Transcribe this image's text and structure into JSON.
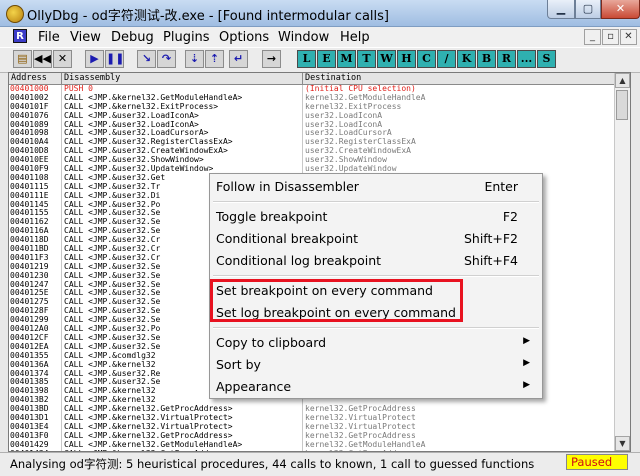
{
  "window": {
    "title": "OllyDbg - od字符测试-改.exe - [Found intermodular calls]"
  },
  "menubar": {
    "items": [
      "File",
      "View",
      "Debug",
      "Plugins",
      "Options",
      "Window",
      "Help"
    ],
    "mdi_icon": "R"
  },
  "toolbar": {
    "letters": [
      "L",
      "E",
      "M",
      "T",
      "W",
      "H",
      "C",
      "/",
      "K",
      "B",
      "R",
      "...",
      "S"
    ]
  },
  "columns": {
    "address": "Address",
    "disassembly": "Disassembly",
    "destination": "Destination"
  },
  "rows": [
    {
      "addr": "00401000",
      "dis": "PUSH 0",
      "dst": "(Initial CPU selection)",
      "selected": true
    },
    {
      "addr": "00401002",
      "dis": "CALL <JMP.&kernel32.GetModuleHandleA>",
      "dst": "kernel32.GetModuleHandleA"
    },
    {
      "addr": "0040101F",
      "dis": "CALL <JMP.&kernel32.ExitProcess>",
      "dst": "kernel32.ExitProcess"
    },
    {
      "addr": "00401076",
      "dis": "CALL <JMP.&user32.LoadIconA>",
      "dst": "user32.LoadIconA"
    },
    {
      "addr": "00401089",
      "dis": "CALL <JMP.&user32.LoadIconA>",
      "dst": "user32.LoadIconA"
    },
    {
      "addr": "00401098",
      "dis": "CALL <JMP.&user32.LoadCursorA>",
      "dst": "user32.LoadCursorA"
    },
    {
      "addr": "004010A4",
      "dis": "CALL <JMP.&user32.RegisterClassExA>",
      "dst": "user32.RegisterClassExA"
    },
    {
      "addr": "004010D8",
      "dis": "CALL <JMP.&user32.CreateWindowExA>",
      "dst": "user32.CreateWindowExA"
    },
    {
      "addr": "004010EE",
      "dis": "CALL <JMP.&user32.ShowWindow>",
      "dst": "user32.ShowWindow"
    },
    {
      "addr": "004010F9",
      "dis": "CALL <JMP.&user32.UpdateWindow>",
      "dst": "user32.UpdateWindow"
    },
    {
      "addr": "00401108",
      "dis": "CALL <JMP.&user32.Get",
      "dst": ""
    },
    {
      "addr": "00401115",
      "dis": "CALL <JMP.&user32.Tr",
      "dst": ""
    },
    {
      "addr": "0040111E",
      "dis": "CALL <JMP.&user32.Di",
      "dst": ""
    },
    {
      "addr": "00401145",
      "dis": "CALL <JMP.&user32.Po",
      "dst": ""
    },
    {
      "addr": "00401155",
      "dis": "CALL <JMP.&user32.Se",
      "dst": ""
    },
    {
      "addr": "00401162",
      "dis": "CALL <JMP.&user32.Se",
      "dst": ""
    },
    {
      "addr": "0040116A",
      "dis": "CALL <JMP.&user32.Se",
      "dst": ""
    },
    {
      "addr": "0040118D",
      "dis": "CALL <JMP.&user32.Cr",
      "dst": ""
    },
    {
      "addr": "004011BD",
      "dis": "CALL <JMP.&user32.Cr",
      "dst": ""
    },
    {
      "addr": "004011F3",
      "dis": "CALL <JMP.&user32.Cr",
      "dst": ""
    },
    {
      "addr": "00401219",
      "dis": "CALL <JMP.&user32.Se",
      "dst": ""
    },
    {
      "addr": "00401230",
      "dis": "CALL <JMP.&user32.Se",
      "dst": ""
    },
    {
      "addr": "00401247",
      "dis": "CALL <JMP.&user32.Se",
      "dst": ""
    },
    {
      "addr": "0040125E",
      "dis": "CALL <JMP.&user32.Se",
      "dst": ""
    },
    {
      "addr": "00401275",
      "dis": "CALL <JMP.&user32.Se",
      "dst": ""
    },
    {
      "addr": "0040128F",
      "dis": "CALL <JMP.&user32.Se",
      "dst": ""
    },
    {
      "addr": "00401299",
      "dis": "CALL <JMP.&user32.Se",
      "dst": ""
    },
    {
      "addr": "004012A0",
      "dis": "CALL <JMP.&user32.Po",
      "dst": ""
    },
    {
      "addr": "004012CF",
      "dis": "CALL <JMP.&user32.Se",
      "dst": ""
    },
    {
      "addr": "004012EA",
      "dis": "CALL <JMP.&user32.Se",
      "dst": ""
    },
    {
      "addr": "00401355",
      "dis": "CALL <JMP.&comdlg32",
      "dst": ""
    },
    {
      "addr": "0040136A",
      "dis": "CALL <JMP.&kernel32",
      "dst": ""
    },
    {
      "addr": "00401374",
      "dis": "CALL <JMP.&user32.Re",
      "dst": ""
    },
    {
      "addr": "00401385",
      "dis": "CALL <JMP.&user32.Se",
      "dst": ""
    },
    {
      "addr": "00401398",
      "dis": "CALL <JMP.&kernel32",
      "dst": ""
    },
    {
      "addr": "004013B2",
      "dis": "CALL <JMP.&kernel32",
      "dst": ""
    },
    {
      "addr": "004013BD",
      "dis": "CALL <JMP.&kernel32.GetProcAddress>",
      "dst": "kernel32.GetProcAddress"
    },
    {
      "addr": "004013D1",
      "dis": "CALL <JMP.&kernel32.VirtualProtect>",
      "dst": "kernel32.VirtualProtect"
    },
    {
      "addr": "004013E4",
      "dis": "CALL <JMP.&kernel32.VirtualProtect>",
      "dst": "kernel32.VirtualProtect"
    },
    {
      "addr": "004013F0",
      "dis": "CALL <JMP.&kernel32.GetProcAddress>",
      "dst": "kernel32.GetProcAddress"
    },
    {
      "addr": "00401429",
      "dis": "CALL <JMP.&kernel32.GetModuleHandleA>",
      "dst": "kernel32.GetModuleHandleA"
    },
    {
      "addr": "00401434",
      "dis": "CALL <JMP.&kernel32.GetProcAddress>",
      "dst": "kernel32.GetProcAddress"
    },
    {
      "addr": "00401445",
      "dis": "CALL <JMP.&kernel32.VirtualProtect>",
      "dst": "kernel32.VirtualProtect"
    }
  ],
  "context_menu": {
    "follow": {
      "label": "Follow in Disassembler",
      "key": "Enter"
    },
    "toggle": {
      "label": "Toggle breakpoint",
      "key": "F2"
    },
    "conditional": {
      "label": "Conditional breakpoint",
      "key": "Shift+F2"
    },
    "cond_log": {
      "label": "Conditional log breakpoint",
      "key": "Shift+F4"
    },
    "set_bp_all": {
      "label": "Set breakpoint on every command"
    },
    "set_log_all": {
      "label": "Set log breakpoint on every command"
    },
    "copy": {
      "label": "Copy to clipboard"
    },
    "sort": {
      "label": "Sort by"
    },
    "appearance": {
      "label": "Appearance"
    }
  },
  "status": {
    "text": "Analysing od字符测: 5 heuristical procedures, 44 calls to known, 1 call to guessed functions",
    "state": "Paused"
  },
  "colors": {
    "highlight_box": "#e81220",
    "paused_bg": "#ffff00",
    "selected_text": "#e0201a"
  }
}
